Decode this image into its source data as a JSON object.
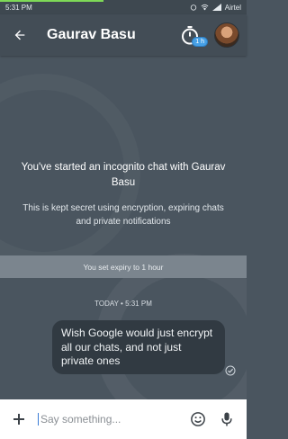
{
  "status_bar": {
    "time": "5:31 PM",
    "carrier": "Airtel"
  },
  "app_bar": {
    "title": "Gaurav Basu",
    "timer_label": "1 h"
  },
  "chat": {
    "intro_title": "You've started an incognito chat with Gaurav Basu",
    "intro_subtitle": "This is kept secret using encryption, expiring chats and private notifications",
    "expiry_notice": "You set expiry to 1 hour",
    "timestamp": "TODAY • 5:31 PM",
    "messages": [
      {
        "text": "Wish Google would just encrypt all our chats, and not just private ones"
      }
    ]
  },
  "composer": {
    "placeholder": "Say something..."
  },
  "colors": {
    "accent": "#46a0e6",
    "background": "#4a555f"
  }
}
